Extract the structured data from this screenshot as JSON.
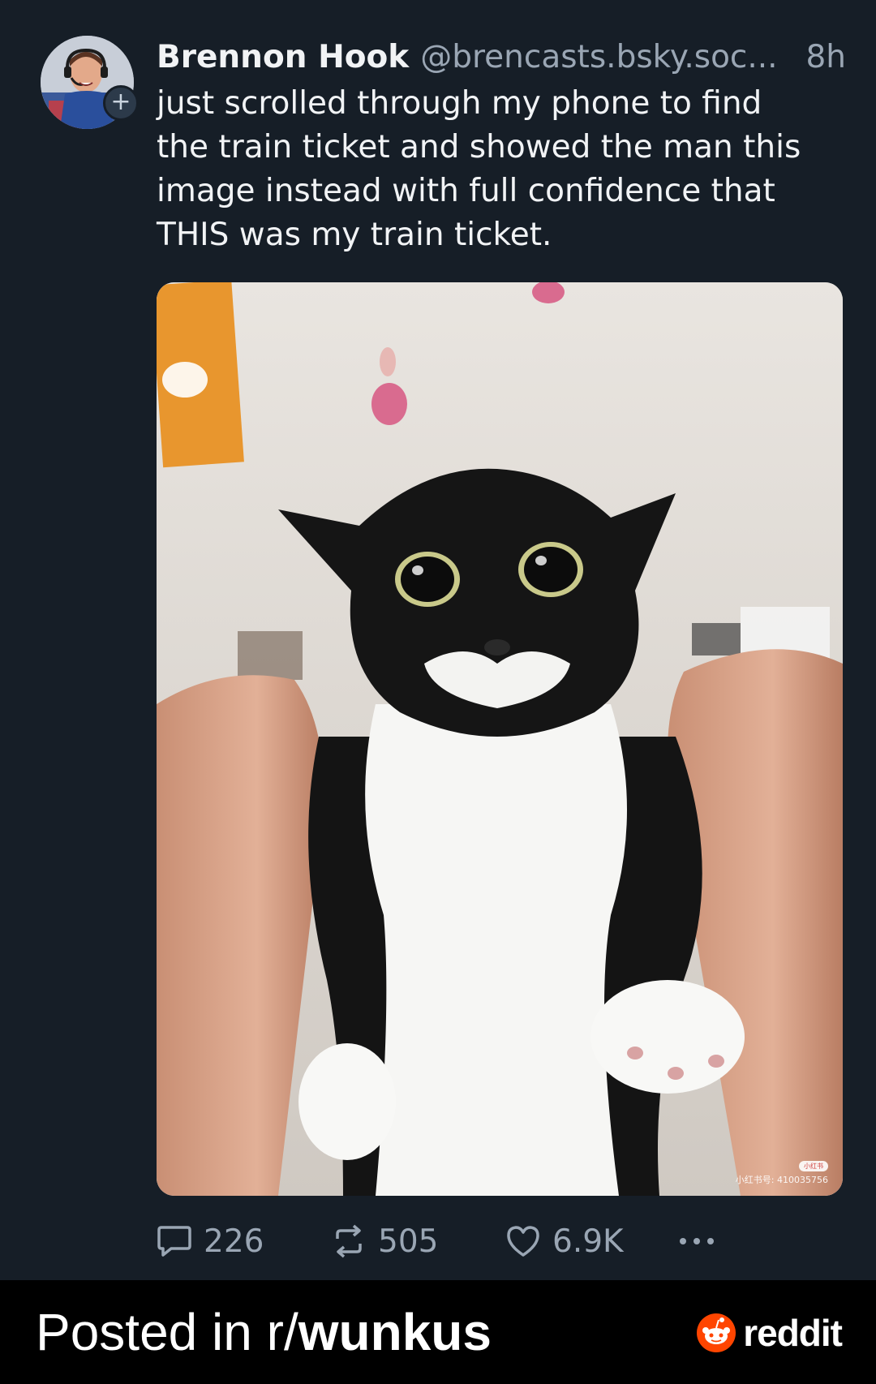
{
  "post": {
    "author_name": "Brennon Hook",
    "author_handle": "@brencasts.bsky.soc...",
    "time": "8h",
    "text": "just scrolled through my phone to find\nthe train ticket and showed the man this\nimage instead with full confidence that\nTHIS was my train ticket.",
    "avatar_icon": "avatar-photo",
    "follow_badge": "+",
    "image_watermark_logo": "小红书",
    "image_watermark_text": "小红书号: 410035756"
  },
  "actions": {
    "replies": "226",
    "reposts": "505",
    "likes": "6.9K"
  },
  "footer": {
    "posted_in": "Posted in r/",
    "subreddit": "wunkus",
    "brand": "reddit",
    "brand_color": "#ff4500"
  }
}
